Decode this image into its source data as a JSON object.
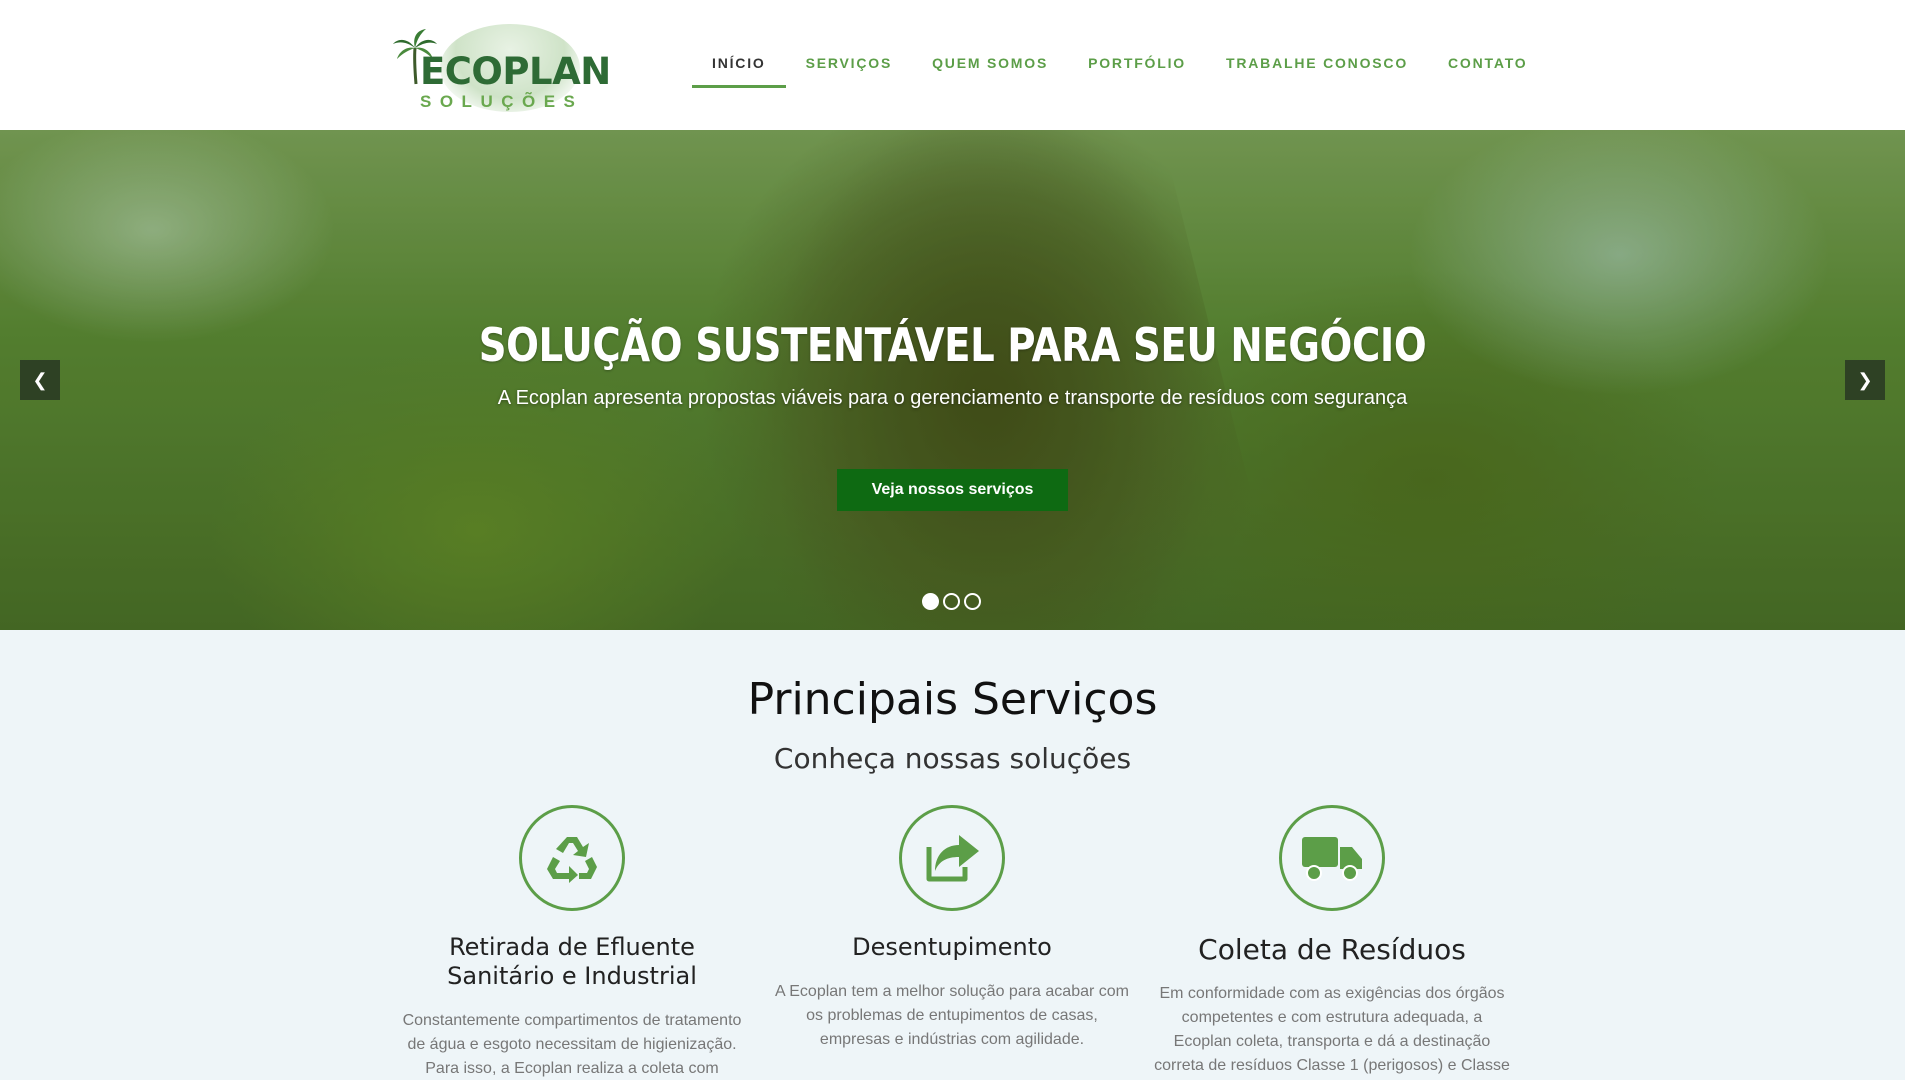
{
  "logo": {
    "name": "ECOPLAN",
    "tagline": "SOLUÇÕES"
  },
  "nav": {
    "items": [
      {
        "label": "INÍCIO",
        "active": true
      },
      {
        "label": "SERVIÇOS",
        "active": false
      },
      {
        "label": "QUEM SOMOS",
        "active": false
      },
      {
        "label": "PORTFÓLIO",
        "active": false
      },
      {
        "label": "TRABALHE CONOSCO",
        "active": false
      },
      {
        "label": "CONTATO",
        "active": false
      }
    ]
  },
  "hero": {
    "title": "SOLUÇÃO SUSTENTÁVEL PARA SEU NEGÓCIO",
    "subtitle": "A Ecoplan apresenta propostas viáveis para o gerenciamento e transporte de resíduos com segurança",
    "button_label": "Veja nossos serviços",
    "prev_icon": "chevron-left-icon",
    "next_icon": "chevron-right-icon",
    "slides": 3,
    "active_slide": 1
  },
  "services": {
    "title": "Principais Serviços",
    "subtitle": "Conheça nossas soluções",
    "cards": [
      {
        "icon": "recycle-icon",
        "title_line1": "Retirada de Efluente",
        "title_line2": "Sanitário e Industrial",
        "text_lines": [
          "Constantemente compartimentos de tratamento",
          "de água e esgoto necessitam de higienização.",
          "Para isso, a Ecoplan realiza a coleta com"
        ]
      },
      {
        "icon": "share-icon",
        "title_line1": "Desentupimento",
        "text_lines": [
          "A Ecoplan tem a melhor solução para acabar com",
          "os problemas de entupimentos de casas,",
          "empresas e indústrias com agilidade."
        ]
      },
      {
        "icon": "truck-icon",
        "title_line1": "Coleta de Resíduos",
        "text_lines": [
          "Em conformidade com as exigências dos órgãos",
          "competentes e com estrutura adequada, a",
          "Ecoplan coleta, transporta e dá a destinação",
          "correta de resíduos Classe 1 (perigosos) e Classe"
        ]
      }
    ]
  },
  "colors": {
    "accent": "#5c9e48",
    "button": "#0e6a12",
    "logo_dark": "#2e6b35",
    "page_bg": "#eef5f8"
  }
}
